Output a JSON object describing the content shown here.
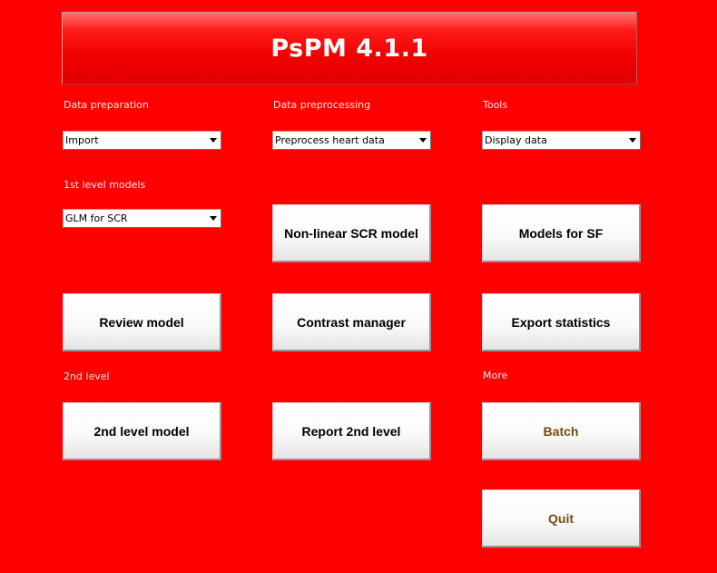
{
  "title": "PsPM 4.1.1",
  "sections": {
    "data_preparation": "Data preparation",
    "data_preprocessing": "Data preprocessing",
    "tools": "Tools",
    "first_level": "1st level models",
    "second_level": "2nd level",
    "more": "More"
  },
  "dropdowns": {
    "data_preparation": "Import",
    "data_preprocessing": "Preprocess heart data",
    "tools": "Display data",
    "first_level": "GLM for SCR"
  },
  "buttons": {
    "nonlinear_scr": "Non-linear SCR model",
    "models_sf": "Models for SF",
    "review_model": "Review model",
    "contrast_manager": "Contrast manager",
    "export_statistics": "Export statistics",
    "second_level_model": "2nd level model",
    "report_second_level": "Report 2nd level",
    "batch": "Batch",
    "quit": "Quit"
  },
  "colors": {
    "background": "#ff0000",
    "special_button_text": "#7a4a10"
  }
}
